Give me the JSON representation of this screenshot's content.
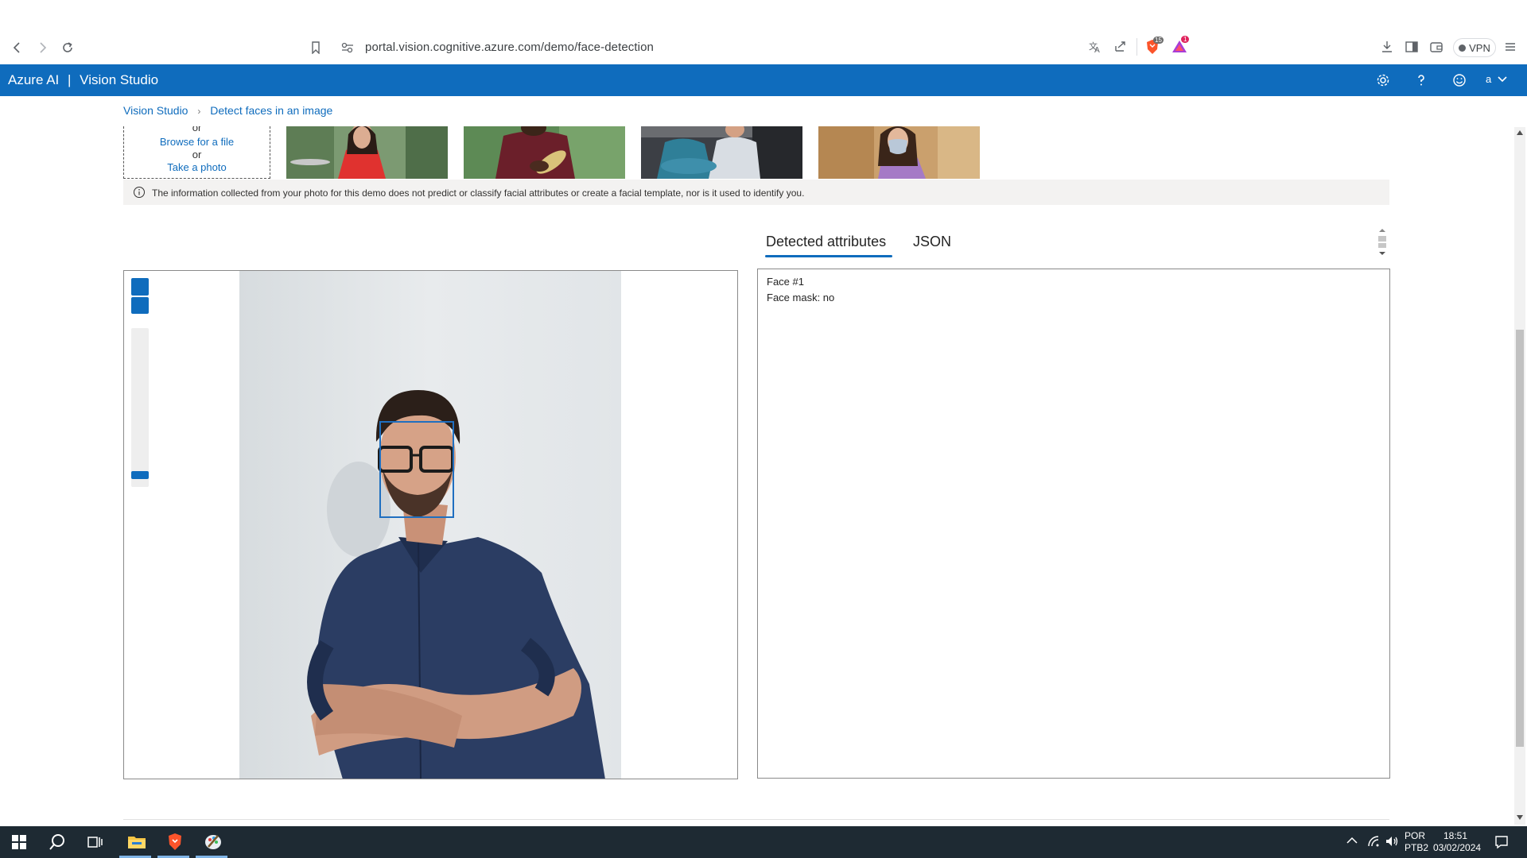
{
  "browser": {
    "url": "portal.vision.cognitive.azure.com/demo/face-detection",
    "vpn_label": "VPN",
    "brave_badge": "15",
    "rewards_badge": "1"
  },
  "header": {
    "brand": "Azure AI",
    "separator": "|",
    "product": "Vision Studio",
    "account_initial": "a"
  },
  "breadcrumb": {
    "items": [
      "Vision Studio",
      "Detect faces in an image"
    ]
  },
  "upload": {
    "or_top": "or",
    "browse_label": "Browse for a file",
    "or_middle": "or",
    "photo_label": "Take a photo"
  },
  "info": {
    "text": "The information collected from your photo for this demo does not predict or classify facial attributes or create a facial template, nor is it used to identify you."
  },
  "tabs": [
    {
      "label": "Detected attributes",
      "selected": true
    },
    {
      "label": "JSON",
      "selected": false
    }
  ],
  "results": {
    "face_title": "Face #1",
    "face_mask": "Face mask: no"
  },
  "taskbar": {
    "lang_top": "POR",
    "lang_bottom": "PTB2",
    "time": "18:51",
    "date": "03/02/2024"
  },
  "colors": {
    "azure_blue": "#0f6cbd",
    "taskbar": "#1e2a33",
    "face_box": "#1f6fc0"
  }
}
